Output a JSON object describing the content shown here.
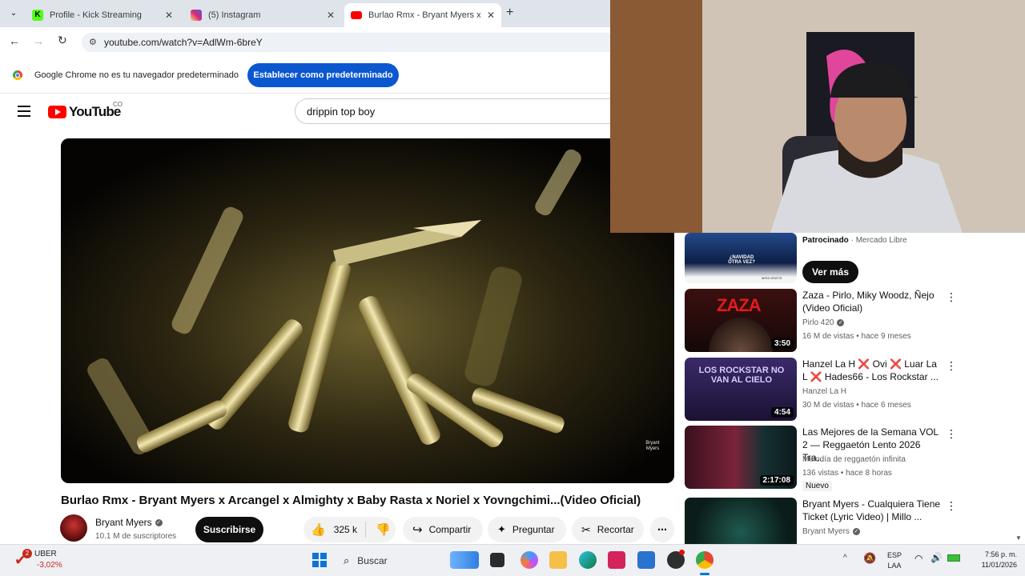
{
  "browser": {
    "tabs": [
      {
        "label": "Profile - Kick Streaming"
      },
      {
        "label": "(5) Instagram"
      },
      {
        "label": "Burlao Rmx - Bryant Myers x Ar"
      }
    ],
    "url": "youtube.com/watch?v=AdlWm-6breY",
    "infobar_text": "Google Chrome no es tu navegador predeterminado",
    "infobar_button": "Establecer como predeterminado"
  },
  "youtube": {
    "logo_text": "YouTube",
    "country_code": "CO",
    "search_value": "drippin top boy",
    "video": {
      "title": "Burlao Rmx - Bryant Myers x Arcangel x Almighty x Baby Rasta x Noriel x Yovngchimi...(Video Oficial)",
      "watermark": "Bryant Myers",
      "channel": "Bryant Myers",
      "subscribers": "10.1 M de suscriptores",
      "subscribe_label": "Suscribirse",
      "likes": "325 k",
      "share_label": "Compartir",
      "ask_label": "Preguntar",
      "clip_label": "Recortar"
    },
    "sidebar": {
      "ad": {
        "sponsored": "Patrocinado",
        "advertiser": "Mercado Libre",
        "cta": "Ver más",
        "thumb_text": "¿NAVIDAD OTRA VEZ?",
        "thumb_sub": "MIRA GRATIS"
      },
      "videos": [
        {
          "title": "Zaza - Pirlo, Miky Woodz, Ñejo (Video Oficial)",
          "channel": "Pirlo 420",
          "verified": true,
          "stats": "16 M de vistas • hace 9 meses",
          "duration": "3:50",
          "thumb_text": "ZAZA",
          "badge": ""
        },
        {
          "title": "Hanzel La H ❌ Ovi ❌ Luar La L ❌ Hades66 - Los Rockstar ...",
          "channel": "Hanzel La H",
          "verified": false,
          "stats": "30 M de vistas • hace 6 meses",
          "duration": "4:54",
          "thumb_text": "LOS ROCKSTAR NO VAN AL CIELO",
          "badge": ""
        },
        {
          "title": "Las Mejores de la Semana VOL 2 — Reggaetón Lento 2026 Tra...",
          "channel": "Melodía de reggaetón infinita",
          "verified": false,
          "stats": "136 vistas • hace 8 horas",
          "duration": "2:17:08",
          "thumb_text": "",
          "badge": "Nuevo"
        },
        {
          "title": "Bryant Myers - Cualquiera Tiene Ticket (Lyric Video) | Millo ...",
          "channel": "Bryant Myers",
          "verified": true,
          "stats": "",
          "duration": "",
          "thumb_text": "",
          "badge": ""
        }
      ]
    }
  },
  "taskbar": {
    "weather_badge": "2",
    "stock_name": "UBER",
    "stock_change": "-3,02%",
    "search_placeholder": "Buscar",
    "lang_top": "ESP",
    "lang_bottom": "LAA",
    "time": "7:56 p. m.",
    "date": "11/01/2026"
  },
  "colors": {
    "yt_red": "#ff0000",
    "chrome_blue": "#0b57d0",
    "stock_red": "#c42b1c"
  }
}
